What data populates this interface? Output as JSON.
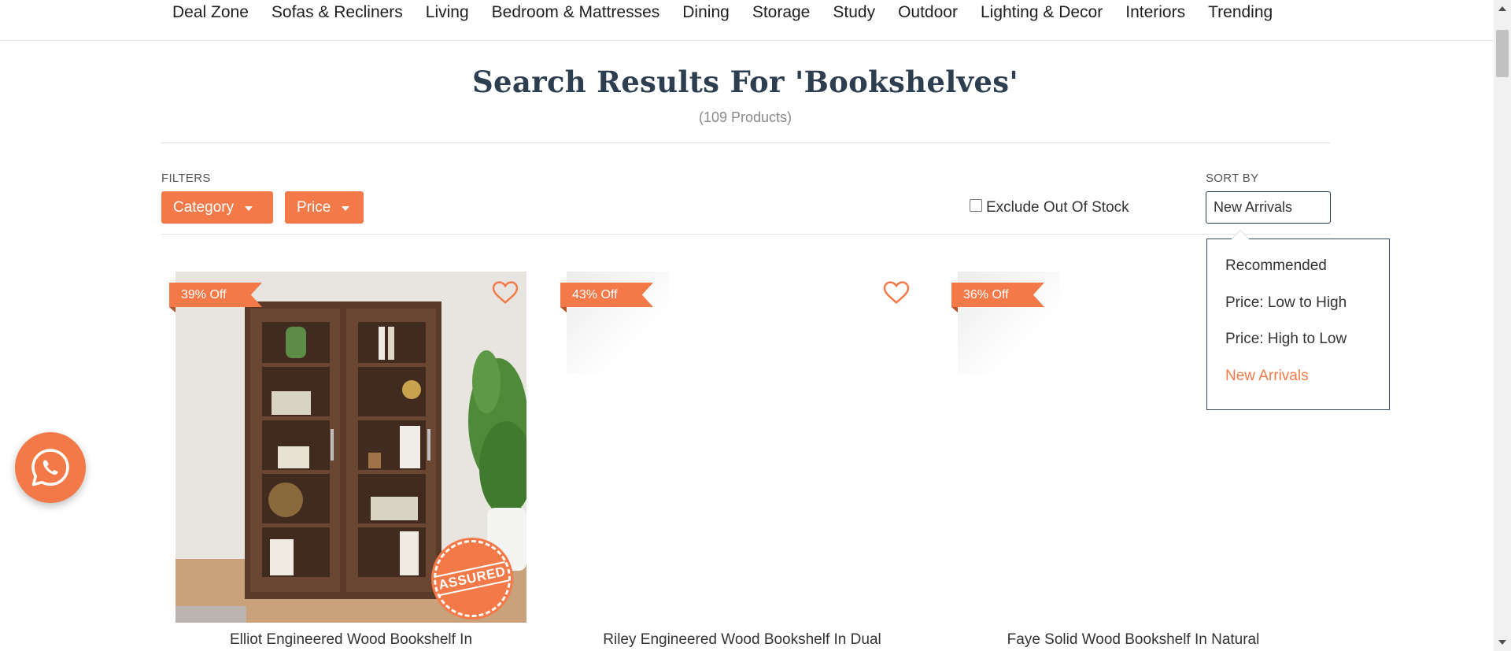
{
  "nav": {
    "items": [
      "Deal Zone",
      "Sofas & Recliners",
      "Living",
      "Bedroom & Mattresses",
      "Dining",
      "Storage",
      "Study",
      "Outdoor",
      "Lighting & Decor",
      "Interiors",
      "Trending"
    ]
  },
  "search": {
    "title": "Search Results For 'Bookshelves'",
    "count": "(109 Products)"
  },
  "filters": {
    "label": "FILTERS",
    "category_label": "Category",
    "price_label": "Price",
    "exclude_label": "Exclude Out Of Stock",
    "exclude_checked": false
  },
  "sort": {
    "label": "SORT BY",
    "selected": "New Arrivals",
    "options": [
      "Recommended",
      "Price: Low to High",
      "Price: High to Low",
      "New Arrivals"
    ]
  },
  "products": [
    {
      "discount": "39% Off",
      "title": "Elliot Engineered Wood Bookshelf In",
      "assured": true,
      "seal_text": "ASSURED"
    },
    {
      "discount": "43% Off",
      "title": "Riley Engineered Wood Bookshelf In Dual",
      "assured": false
    },
    {
      "discount": "36% Off",
      "title": "Faye Solid Wood Bookshelf In Natural",
      "assured": false
    }
  ],
  "colors": {
    "accent": "#f37a48",
    "heading": "#2c3e50"
  },
  "icons": {
    "wishlist": "heart-icon",
    "chat": "whatsapp-icon",
    "dropdown": "caret-down-icon"
  }
}
